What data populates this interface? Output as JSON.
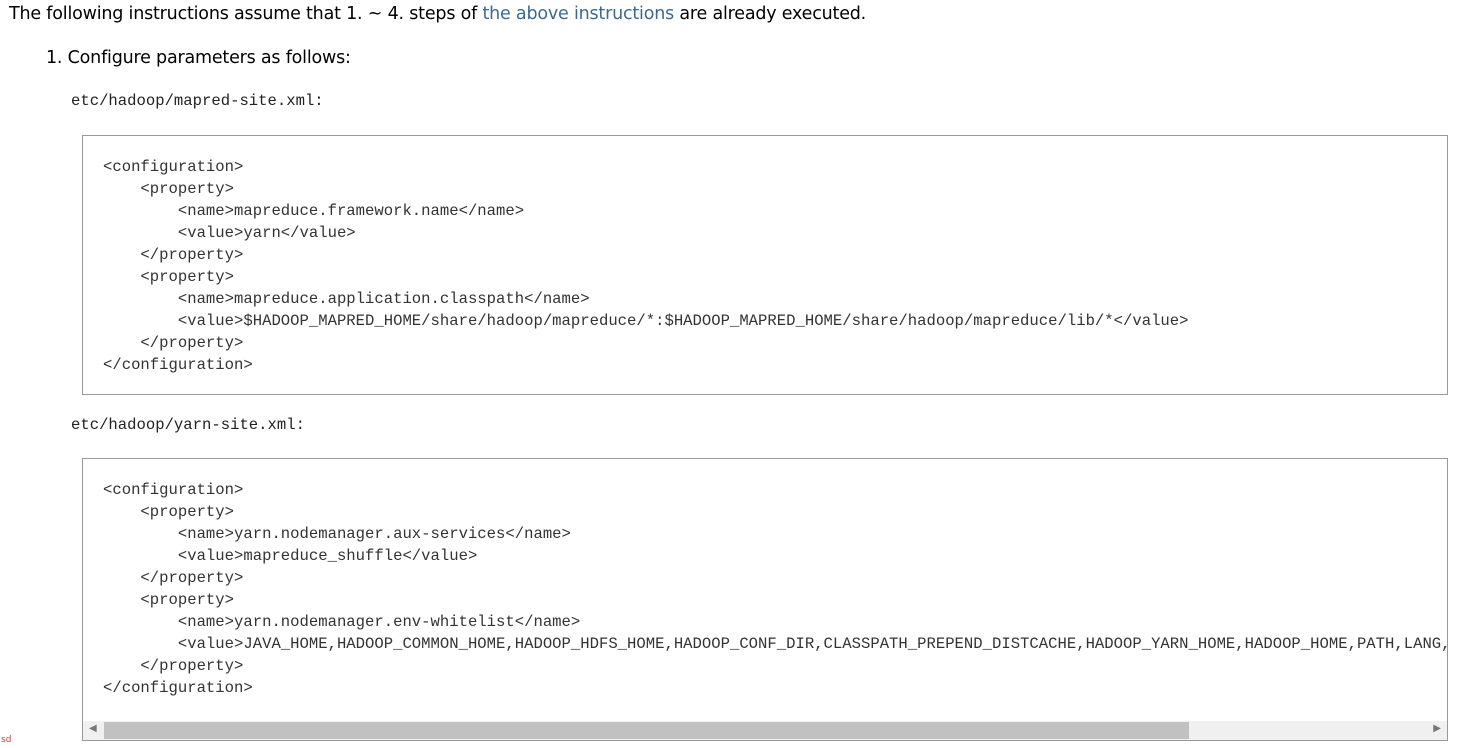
{
  "intro": {
    "before": "The following instructions assume that 1. ~ 4. steps of ",
    "link": "the above instructions",
    "after": " are already executed."
  },
  "step": "1. Configure parameters as follows:",
  "files": [
    {
      "name": "etc/hadoop/mapred-site.xml:",
      "code": "<configuration>\n    <property>\n        <name>mapreduce.framework.name</name>\n        <value>yarn</value>\n    </property>\n    <property>\n        <name>mapreduce.application.classpath</name>\n        <value>$HADOOP_MAPRED_HOME/share/hadoop/mapreduce/*:$HADOOP_MAPRED_HOME/share/hadoop/mapreduce/lib/*</value>\n    </property>\n</configuration>"
    },
    {
      "name": "etc/hadoop/yarn-site.xml:",
      "code": "<configuration>\n    <property>\n        <name>yarn.nodemanager.aux-services</name>\n        <value>mapreduce_shuffle</value>\n    </property>\n    <property>\n        <name>yarn.nodemanager.env-whitelist</name>\n        <value>JAVA_HOME,HADOOP_COMMON_HOME,HADOOP_HDFS_HOME,HADOOP_CONF_DIR,CLASSPATH_PREPEND_DISTCACHE,HADOOP_YARN_HOME,HADOOP_HOME,PATH,LANG,TZ,HADOOP_MAPRED_HOME</value>\n    </property>\n</configuration>"
    }
  ],
  "corner_mark": "sd"
}
